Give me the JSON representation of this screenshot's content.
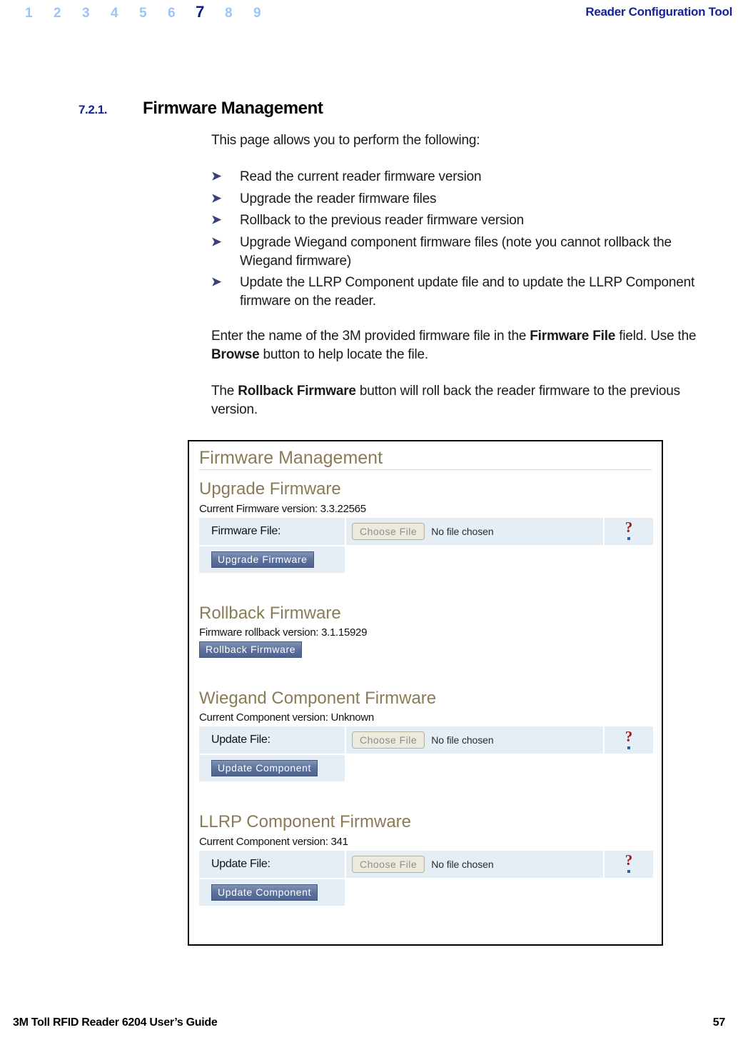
{
  "header": {
    "chapter_numbers": [
      "1",
      "2",
      "3",
      "4",
      "5",
      "6",
      "7",
      "8",
      "9"
    ],
    "current_chapter": "7",
    "title": "Reader Configuration Tool",
    "accent_color": "#14239b",
    "inactive_color": "#9ec4f5"
  },
  "section": {
    "number": "7.2.1.",
    "title": "Firmware Management"
  },
  "body": {
    "intro": "This page allows you to perform the following:",
    "bullets": [
      "Read the current reader firmware version",
      "Upgrade the reader firmware files",
      "Rollback to the previous reader firmware version",
      "Upgrade Wiegand component firmware files (note you cannot rollback the Wiegand firmware)",
      "Update the LLRP Component update file and to update the LLRP Component firmware on the reader."
    ],
    "bullet_glyph": "➤",
    "para_enter_parts": {
      "p1": "Enter the name of the 3M provided firmware file in the ",
      "b1": "Firmware File",
      "p2": " field. Use the ",
      "b2": "Browse",
      "p3": " button to help locate the file."
    },
    "para_rollback_parts": {
      "p1": "The ",
      "b1": "Rollback Firmware",
      "p2": " button will roll back the reader firmware to the previous version."
    }
  },
  "screenshot": {
    "page_title": "Firmware Management",
    "heading_color": "#8a7b55",
    "sections": [
      {
        "heading": "Upgrade Firmware",
        "version_line": "Current Firmware version: 3.3.22565",
        "row_label": "Firmware File:",
        "choose_file_label": "Choose File",
        "file_status": "No file chosen",
        "help_icon": "question-mark-icon",
        "action_button": "Upgrade Firmware"
      },
      {
        "heading": "Rollback Firmware",
        "version_line": "Firmware rollback version: 3.1.15929",
        "action_button": "Rollback Firmware"
      },
      {
        "heading": "Wiegand Component Firmware",
        "version_line": "Current Component version: Unknown",
        "row_label": "Update File:",
        "choose_file_label": "Choose File",
        "file_status": "No file chosen",
        "help_icon": "question-mark-icon",
        "action_button": "Update Component"
      },
      {
        "heading": "LLRP Component Firmware",
        "version_line": "Current Component version: 341",
        "row_label": "Update File:",
        "choose_file_label": "Choose File",
        "file_status": "No file chosen",
        "help_icon": "question-mark-icon",
        "action_button": "Update Component"
      }
    ]
  },
  "footer": {
    "left": "3M Toll RFID Reader 6204 User’s Guide",
    "page_number": "57"
  }
}
